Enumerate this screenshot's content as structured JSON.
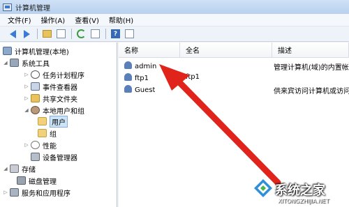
{
  "window": {
    "title": "计算机管理"
  },
  "menu": [
    "文件(F)",
    "操作(A)",
    "查看(V)",
    "帮助(H)"
  ],
  "toolbar": {
    "icons": [
      "back-arrow-icon",
      "forward-arrow-icon",
      "up-folder-icon",
      "show-hide-tree-icon",
      "refresh-icon",
      "export-list-icon",
      "help-icon",
      "properties-icon"
    ],
    "help_glyph": "?"
  },
  "tree": {
    "root": "计算机管理(本地)",
    "system_tools": "系统工具",
    "task_scheduler": "任务计划程序",
    "event_viewer": "事件查看器",
    "shared_folders": "共享文件夹",
    "local_users_groups": "本地用户和组",
    "users": "用户",
    "groups": "组",
    "performance": "性能",
    "device_manager": "设备管理器",
    "storage": "存储",
    "disk_management": "磁盘管理",
    "services_apps": "服务和应用程序"
  },
  "list": {
    "columns": {
      "name": "名称",
      "fullname": "全名",
      "description": "描述"
    },
    "rows": [
      {
        "name": "admin",
        "fullname": "",
        "description": "管理计算机(域)的内置帐"
      },
      {
        "name": "ftp1",
        "fullname": "ftp1",
        "description": ""
      },
      {
        "name": "Guest",
        "fullname": "",
        "description": "供来宾访问计算机或访问"
      }
    ]
  },
  "annotation": {
    "color": "#e0241b",
    "target": "admin"
  },
  "watermark": {
    "text": "系统之家",
    "subtext": "XITONGZHIJIA.NET"
  }
}
